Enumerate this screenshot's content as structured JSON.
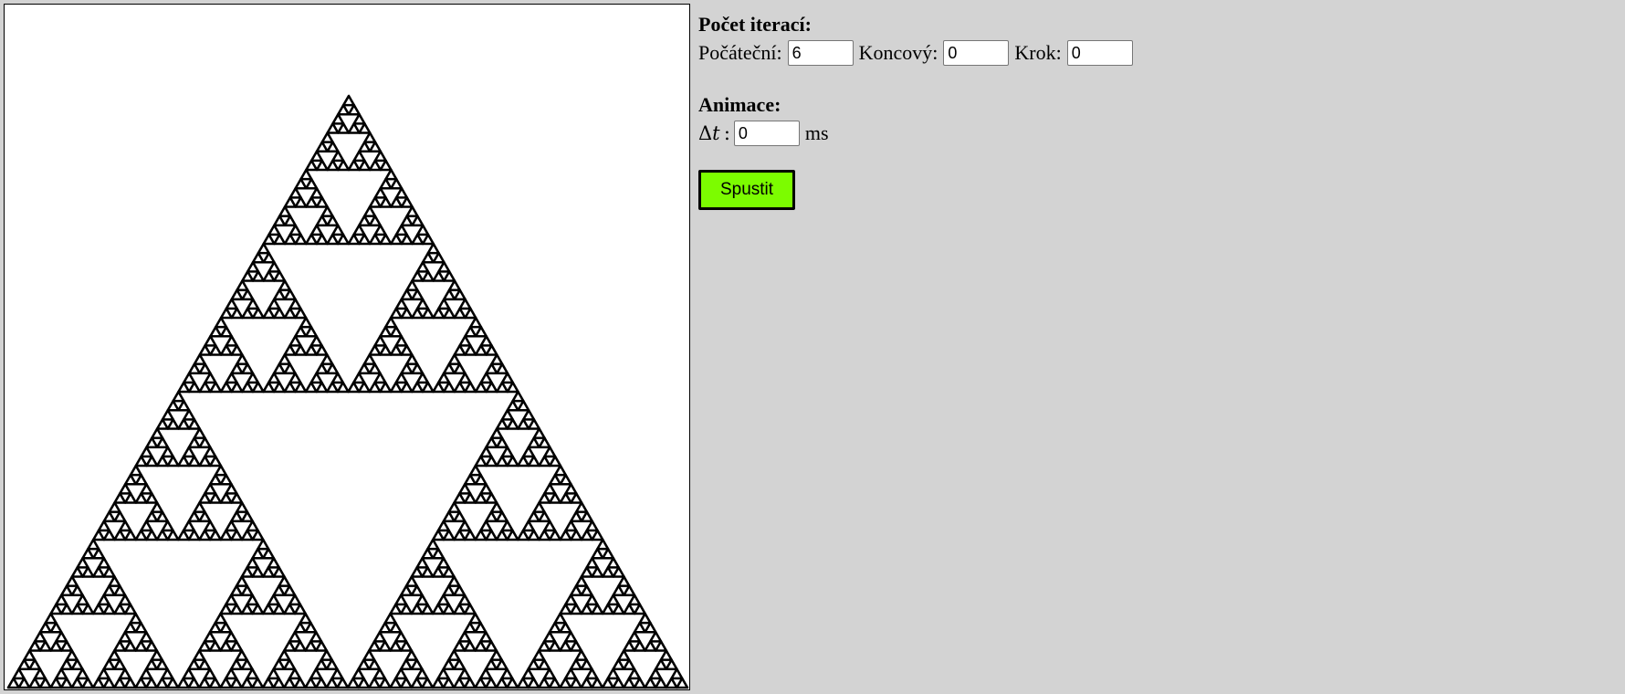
{
  "canvas": {
    "fractal": "sierpinski-triangle",
    "iterations": 6,
    "stroke_color": "#000000",
    "background_color": "#ffffff"
  },
  "iterations": {
    "heading": "Počet iterací:",
    "start_label": "Počáteční:",
    "start_value": "6",
    "end_label": "Koncový:",
    "end_value": "0",
    "step_label": "Krok:",
    "step_value": "0"
  },
  "animation": {
    "heading": "Animace:",
    "delta_symbol": "Δ",
    "delta_var": "t",
    "delta_colon": ":",
    "dt_value": "0",
    "unit": "ms"
  },
  "run_button": {
    "label": "Spustit",
    "color": "#7cfc00"
  },
  "page": {
    "background_color": "#d3d3d3"
  }
}
